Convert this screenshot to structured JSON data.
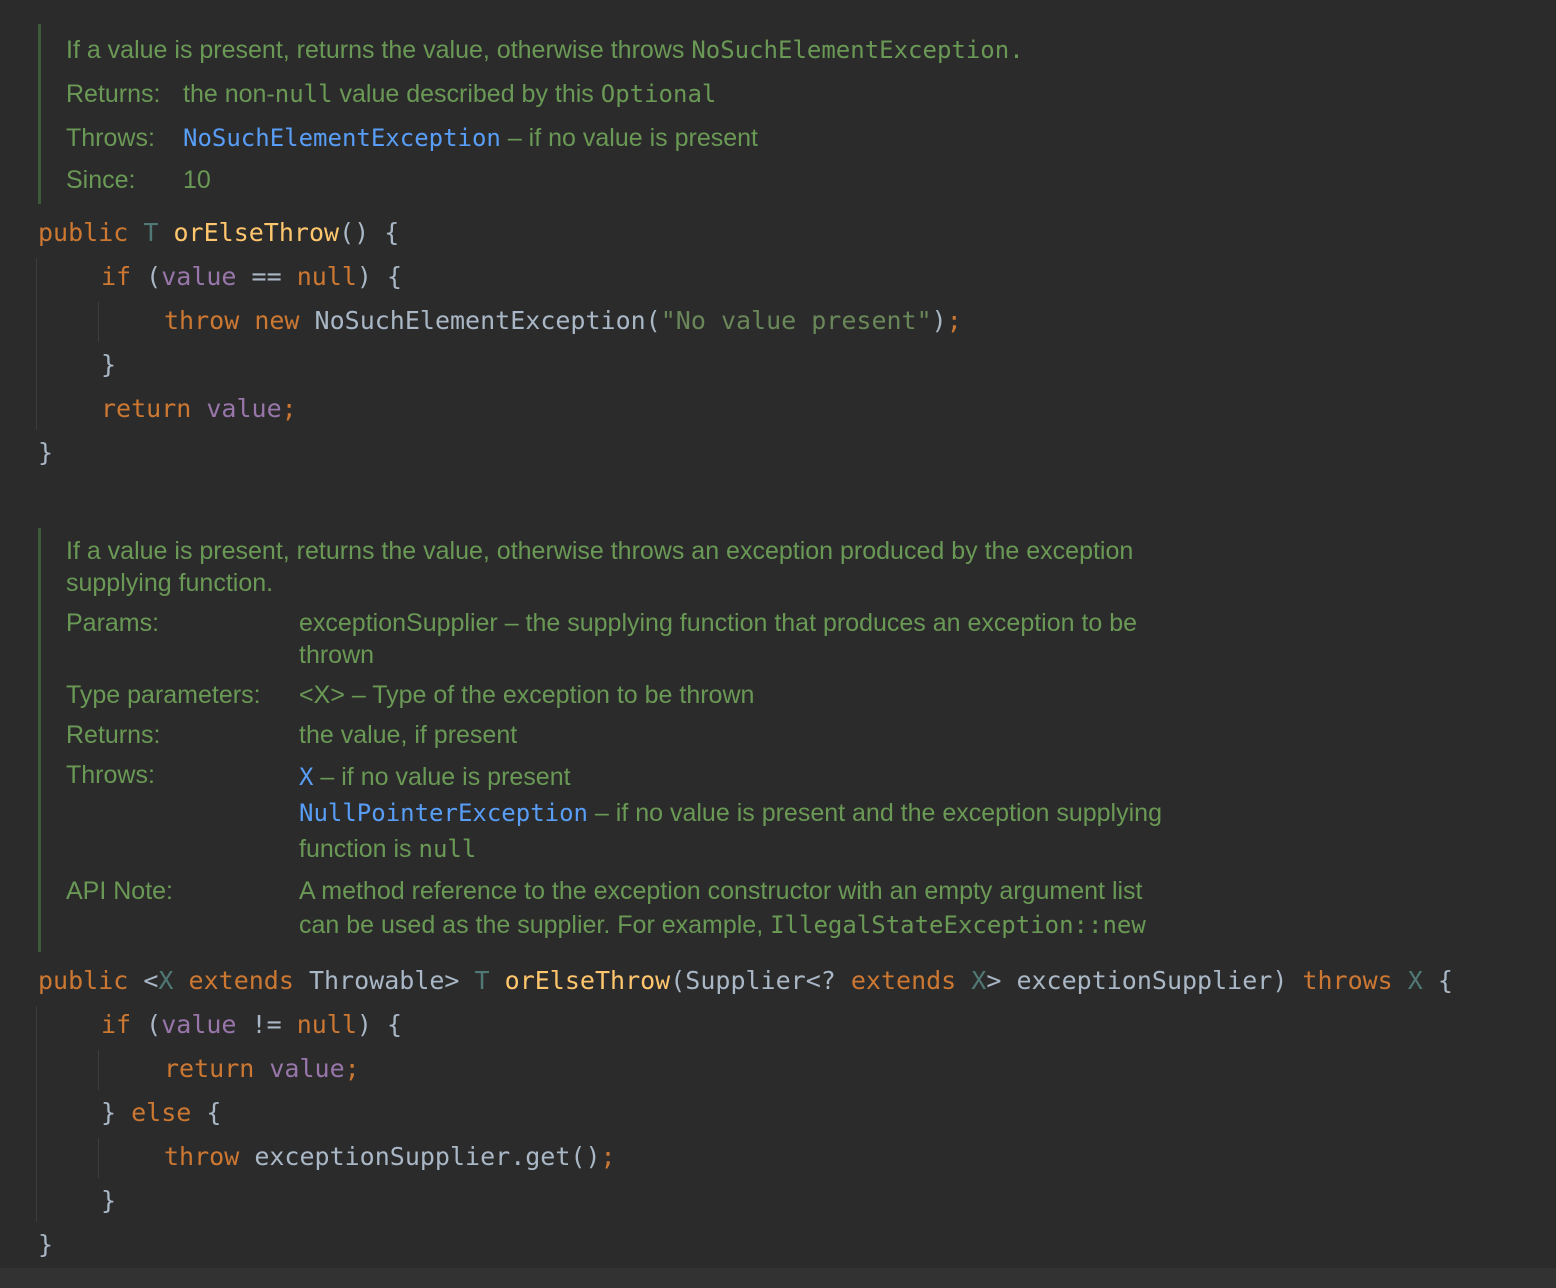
{
  "doc1": {
    "summary": "If a value is present, returns the value, otherwise throws ",
    "summary_code": "NoSuchElementException.",
    "returns_label": "Returns:",
    "returns_pre": "the non-",
    "returns_code1": "null",
    "returns_mid": " value described by this ",
    "returns_code2": "Optional",
    "throws_label": "Throws:",
    "throws_link": "NoSuchElementException",
    "throws_text": " – if no value is present",
    "since_label": "Since:",
    "since_value": "10"
  },
  "code1": {
    "l1_kw": "public",
    "l1_type": "T",
    "l1_fn": "orElseThrow",
    "l1_rest": "() {",
    "l2_kw": "if",
    "l2_open": " (",
    "l2_fld": "value",
    "l2_op": " == ",
    "l2_null": "null",
    "l2_close": ") {",
    "l3_kw1": "throw",
    "l3_kw2": "new",
    "l3_cls": "NoSuchElementException(",
    "l3_str": "\"No value present\"",
    "l3_end": ")",
    "l3_semi": ";",
    "l4": "}",
    "l5_kw": "return",
    "l5_fld": "value",
    "l5_semi": ";",
    "l6": "}"
  },
  "doc2": {
    "summary1": "If a value is present, returns the value, otherwise throws an exception produced by the exception",
    "summary2": "supplying function.",
    "params_label": "Params:",
    "params_val1": "exceptionSupplier – the supplying function that produces an exception to be",
    "params_val2": "thrown",
    "typeparams_label": "Type parameters:",
    "typeparams_val": "<X> – Type of the exception to be thrown",
    "returns_label": "Returns:",
    "returns_val": "the value, if present",
    "throws_label": "Throws:",
    "throws_link1": "X",
    "throws_text1": " – if no value is present",
    "throws_link2": "NullPointerException",
    "throws_text2": " – if no value is present and the exception supplying",
    "throws_text3_pre": "function is ",
    "throws_text3_code": "null",
    "apinote_label": "API Note:",
    "apinote_val1": "A method reference to the exception constructor with an empty argument list",
    "apinote_val2_pre": "can be used as the supplier. For example, ",
    "apinote_val2_code": "IllegalStateException::new"
  },
  "code2": {
    "l1_kw": "public",
    "l1_lt": " <",
    "l1_x": "X",
    "l1_ext": "extends",
    "l1_thr": " Throwable> ",
    "l1_t": "T",
    "l1_fn": "orElseThrow",
    "l1_params": "(Supplier<? ",
    "l1_ext2": "extends",
    "l1_x2": "X",
    "l1_params2": "> exceptionSupplier) ",
    "l1_throws": "throws",
    "l1_x3": "X",
    "l1_brace": " {",
    "l2_kw": "if",
    "l2_open": " (",
    "l2_fld": "value",
    "l2_op": " != ",
    "l2_null": "null",
    "l2_close": ") {",
    "l3_kw": "return",
    "l3_fld": "value",
    "l3_semi": ";",
    "l4_close": "} ",
    "l4_else": "else",
    "l4_brace": " {",
    "l5_kw": "throw",
    "l5_rest": " exceptionSupplier.get()",
    "l5_semi": ";",
    "l6": "}",
    "l7": "}"
  }
}
